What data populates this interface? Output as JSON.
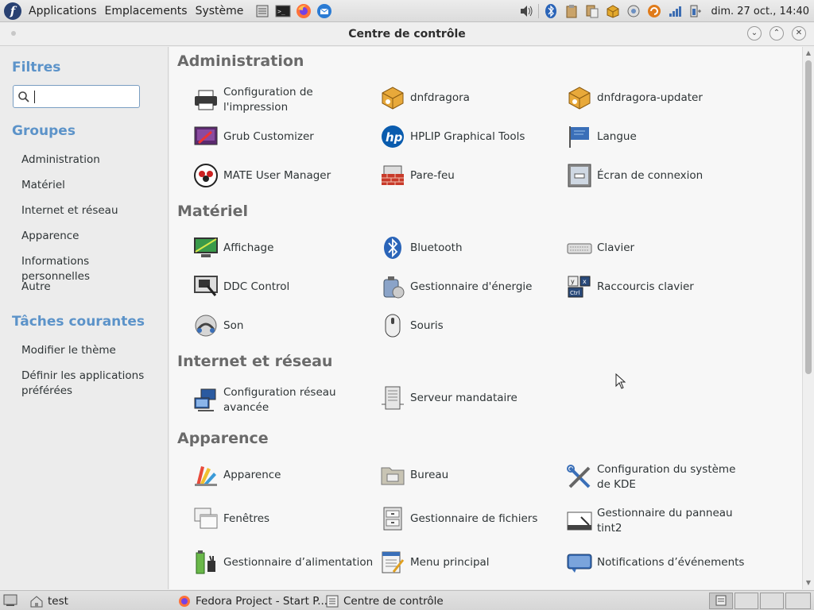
{
  "top_panel": {
    "menus": [
      "Applications",
      "Emplacements",
      "Système"
    ],
    "clock": "dim. 27 oct., 14:40"
  },
  "window": {
    "title": "Centre de contrôle"
  },
  "sidebar": {
    "filters_heading": "Filtres",
    "search_value": "",
    "groups_heading": "Groupes",
    "groups": [
      "Administration",
      "Matériel",
      "Internet et réseau",
      "Apparence",
      "Informations personnelles",
      "Autre"
    ],
    "tasks_heading": "Tâches courantes",
    "tasks": [
      "Modifier le thème",
      "Définir les applications préférées"
    ]
  },
  "content": {
    "groups": [
      {
        "title": "Administration",
        "items": [
          {
            "label": "Configuration de l'impression",
            "icon": "printer-icon"
          },
          {
            "label": "dnfdragora",
            "icon": "package-icon"
          },
          {
            "label": "dnfdragora-updater",
            "icon": "package-update-icon"
          },
          {
            "label": "Grub Customizer",
            "icon": "grub-icon"
          },
          {
            "label": "HPLIP Graphical Tools",
            "icon": "hp-icon"
          },
          {
            "label": "Langue",
            "icon": "flag-icon"
          },
          {
            "label": "MATE User Manager",
            "icon": "users-icon"
          },
          {
            "label": "Pare-feu",
            "icon": "firewall-icon"
          },
          {
            "label": "Écran de connexion",
            "icon": "login-screen-icon"
          }
        ]
      },
      {
        "title": "Matériel",
        "items": [
          {
            "label": "Affichage",
            "icon": "display-icon"
          },
          {
            "label": "Bluetooth",
            "icon": "bluetooth-icon"
          },
          {
            "label": "Clavier",
            "icon": "keyboard-icon"
          },
          {
            "label": "DDC Control",
            "icon": "ddc-monitor-icon"
          },
          {
            "label": "Gestionnaire d'énergie",
            "icon": "power-manager-icon"
          },
          {
            "label": "Raccourcis clavier",
            "icon": "keyboard-shortcuts-icon"
          },
          {
            "label": "Son",
            "icon": "sound-icon"
          },
          {
            "label": "Souris",
            "icon": "mouse-icon"
          }
        ]
      },
      {
        "title": "Internet et réseau",
        "items": [
          {
            "label": "Configuration réseau avancée",
            "icon": "network-icon"
          },
          {
            "label": "Serveur mandataire",
            "icon": "proxy-server-icon"
          }
        ]
      },
      {
        "title": "Apparence",
        "items": [
          {
            "label": "Apparence",
            "icon": "appearance-icon"
          },
          {
            "label": "Bureau",
            "icon": "desktop-folder-icon"
          },
          {
            "label": "Configuration du système de KDE",
            "icon": "kde-tools-icon"
          },
          {
            "label": "Fenêtres",
            "icon": "windows-icon"
          },
          {
            "label": "Gestionnaire de fichiers",
            "icon": "file-manager-icon"
          },
          {
            "label": "Gestionnaire du panneau tint2",
            "icon": "panel-icon"
          },
          {
            "label": "Gestionnaire d’alimentation",
            "icon": "battery-icon"
          },
          {
            "label": "Menu principal",
            "icon": "menu-editor-icon"
          },
          {
            "label": "Notifications d’événements",
            "icon": "notification-icon"
          }
        ]
      }
    ]
  },
  "bottom_panel": {
    "tasks": [
      "test",
      "Fedora Project - Start P...",
      "Centre de contrôle"
    ]
  }
}
